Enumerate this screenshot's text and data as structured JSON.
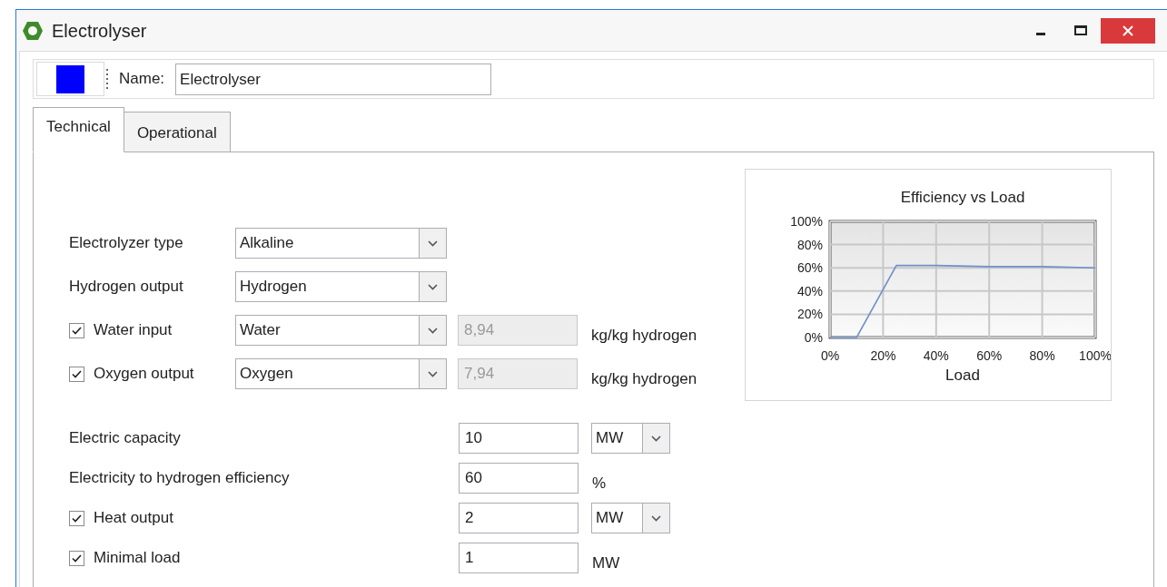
{
  "window": {
    "title": "Electrolyser"
  },
  "name_label": "Name:",
  "name_value": "Electrolyser",
  "tabs": [
    {
      "label": "Technical",
      "selected": true
    },
    {
      "label": "Operational",
      "selected": false
    }
  ],
  "rows_top": [
    {
      "label": "Electrolyzer type",
      "select": "Alkaline"
    },
    {
      "label": "Hydrogen output",
      "select": "Hydrogen"
    },
    {
      "label": "Water input",
      "checked": true,
      "select": "Water",
      "amount": "8,94",
      "amount_disabled": true,
      "unit": "kg/kg hydrogen"
    },
    {
      "label": "Oxygen output",
      "checked": true,
      "select": "Oxygen",
      "amount": "7,94",
      "amount_disabled": true,
      "unit": "kg/kg hydrogen"
    }
  ],
  "rows_bottom": [
    {
      "label": "Electric capacity",
      "amount": "10",
      "amount_disabled": false,
      "unit_select": "MW"
    },
    {
      "label": "Electricity to hydrogen efficiency",
      "amount": "60",
      "amount_disabled": false,
      "unit": "%"
    },
    {
      "label": "Heat output",
      "checked": true,
      "amount": "2",
      "amount_disabled": false,
      "unit_select": "MW"
    },
    {
      "label": "Minimal load",
      "checked": true,
      "amount": "1",
      "amount_disabled": false,
      "unit": "MW"
    }
  ],
  "chart_data": {
    "type": "line",
    "title": "Efficiency vs Load",
    "xlabel": "Load",
    "xlim": [
      0,
      100
    ],
    "ylim": [
      0,
      100
    ],
    "xticks": [
      {
        "value": 0,
        "label": "0%"
      },
      {
        "value": 20,
        "label": "20%"
      },
      {
        "value": 40,
        "label": "40%"
      },
      {
        "value": 60,
        "label": "60%"
      },
      {
        "value": 80,
        "label": "80%"
      },
      {
        "value": 100,
        "label": "100%"
      }
    ],
    "grid": true,
    "yticks": [
      {
        "value": 0,
        "label": "0%"
      },
      {
        "value": 20,
        "label": "20%"
      },
      {
        "value": 40,
        "label": "40%"
      },
      {
        "value": 60,
        "label": "60%"
      },
      {
        "value": 80,
        "label": "80%"
      },
      {
        "value": 100,
        "label": "100%"
      }
    ],
    "x": [
      0,
      10,
      25,
      40,
      60,
      80,
      100
    ],
    "series": [
      {
        "color": "#6f8fc8",
        "values": [
          0,
          0,
          62,
          62,
          61,
          61,
          60
        ]
      }
    ]
  }
}
